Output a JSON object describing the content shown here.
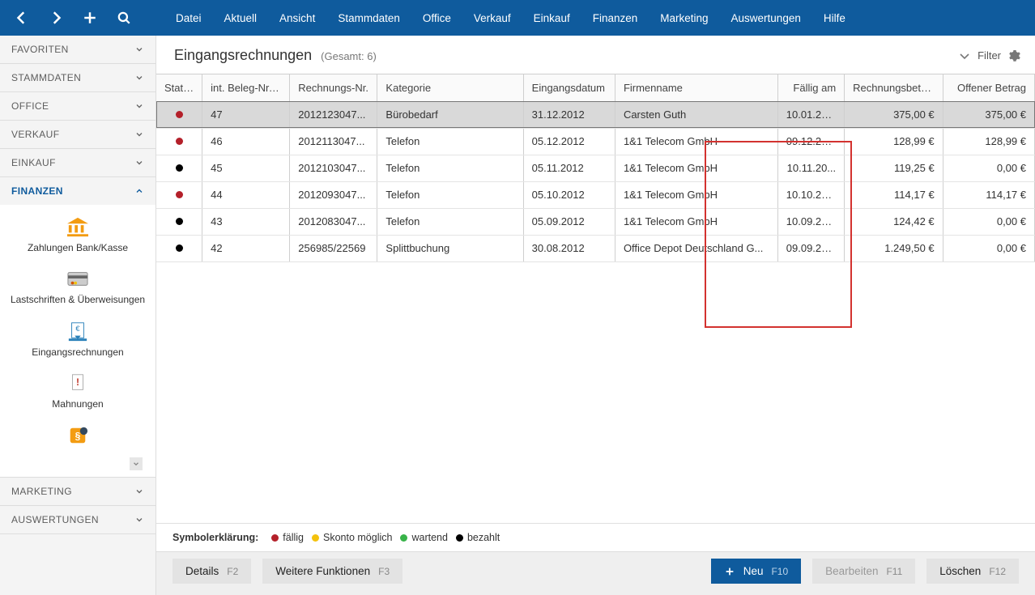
{
  "menu": [
    "Datei",
    "Aktuell",
    "Ansicht",
    "Stammdaten",
    "Office",
    "Verkauf",
    "Einkauf",
    "Finanzen",
    "Marketing",
    "Auswertungen",
    "Hilfe"
  ],
  "sidebar": {
    "sections": [
      {
        "label": "FAVORITEN",
        "expanded": false
      },
      {
        "label": "STAMMDATEN",
        "expanded": false
      },
      {
        "label": "OFFICE",
        "expanded": false
      },
      {
        "label": "VERKAUF",
        "expanded": false
      },
      {
        "label": "EINKAUF",
        "expanded": false
      },
      {
        "label": "FINANZEN",
        "expanded": true,
        "items": [
          {
            "label": "Zahlungen Bank/Kasse",
            "icon": "bank"
          },
          {
            "label": "Lastschriften & Überweisungen",
            "icon": "card"
          },
          {
            "label": "Eingangsrechnungen",
            "icon": "invoice-in"
          },
          {
            "label": "Mahnungen",
            "icon": "warning-doc"
          },
          {
            "label": "",
            "icon": "paragraph"
          }
        ]
      },
      {
        "label": "MARKETING",
        "expanded": false
      },
      {
        "label": "AUSWERTUNGEN",
        "expanded": false
      }
    ]
  },
  "page": {
    "title": "Eingangsrechnungen",
    "count_label": "(Gesamt: 6)",
    "filter_label": "Filter"
  },
  "table": {
    "columns": [
      "Status",
      "int. Beleg-Nr.",
      "Rechnungs-Nr.",
      "Kategorie",
      "Eingangsdatum",
      "Firmenname",
      "Fällig am",
      "Rechnungsbetrag",
      "Offener Betrag"
    ],
    "sort_column": 1,
    "highlight_column": 3,
    "rows": [
      {
        "selected": true,
        "status": "red",
        "beleg": "47",
        "rnr": "2012123047...",
        "kat": "Bürobedarf",
        "edat": "31.12.2012",
        "firma": "Carsten Guth",
        "faellig": "10.01.20...",
        "betrag": "375,00 €",
        "offen": "375,00 €"
      },
      {
        "status": "red",
        "beleg": "46",
        "rnr": "2012113047...",
        "kat": "Telefon",
        "edat": "05.12.2012",
        "firma": "1&1 Telecom GmbH",
        "faellig": "09.12.20...",
        "betrag": "128,99 €",
        "offen": "128,99 €"
      },
      {
        "status": "black",
        "beleg": "45",
        "rnr": "2012103047...",
        "kat": "Telefon",
        "edat": "05.11.2012",
        "firma": "1&1 Telecom GmbH",
        "faellig": "10.11.20...",
        "betrag": "119,25 €",
        "offen": "0,00 €"
      },
      {
        "status": "red",
        "beleg": "44",
        "rnr": "2012093047...",
        "kat": "Telefon",
        "edat": "05.10.2012",
        "firma": "1&1 Telecom GmbH",
        "faellig": "10.10.20...",
        "betrag": "114,17 €",
        "offen": "114,17 €"
      },
      {
        "status": "black",
        "beleg": "43",
        "rnr": "2012083047...",
        "kat": "Telefon",
        "edat": "05.09.2012",
        "firma": "1&1 Telecom GmbH",
        "faellig": "10.09.20...",
        "betrag": "124,42 €",
        "offen": "0,00 €"
      },
      {
        "status": "black",
        "beleg": "42",
        "rnr": "256985/22569",
        "kat": "Splittbuchung",
        "edat": "30.08.2012",
        "firma": "Office Depot Deutschland G...",
        "faellig": "09.09.20...",
        "betrag": "1.249,50 €",
        "offen": "0,00 €"
      }
    ]
  },
  "legend": {
    "title": "Symbolerklärung:",
    "items": [
      {
        "color": "red",
        "label": "fällig"
      },
      {
        "color": "yellow",
        "label": "Skonto möglich"
      },
      {
        "color": "green",
        "label": "wartend"
      },
      {
        "color": "black",
        "label": "bezahlt"
      }
    ]
  },
  "footer": {
    "details": {
      "label": "Details",
      "shortcut": "F2"
    },
    "more": {
      "label": "Weitere Funktionen",
      "shortcut": "F3"
    },
    "new": {
      "label": "Neu",
      "shortcut": "F10"
    },
    "edit": {
      "label": "Bearbeiten",
      "shortcut": "F11"
    },
    "delete": {
      "label": "Löschen",
      "shortcut": "F12"
    }
  }
}
